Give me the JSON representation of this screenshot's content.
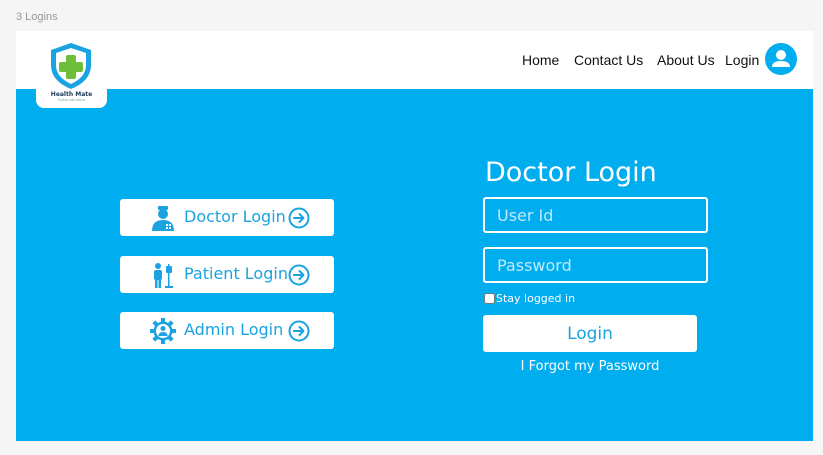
{
  "frame_label": "3 Logins",
  "logo": {
    "name": "Health Mate",
    "tagline": "Follow with Africa"
  },
  "nav": {
    "items": [
      {
        "id": "home",
        "label": "Home"
      },
      {
        "id": "contact",
        "label": "Contact Us"
      },
      {
        "id": "about",
        "label": "About Us"
      },
      {
        "id": "login",
        "label": "Login"
      }
    ],
    "avatar_icon": "user-icon"
  },
  "roles": [
    {
      "id": "doctor",
      "label": "Doctor Login",
      "icon": "doctor-icon",
      "arrow_icon": "arrow-right-circle-icon"
    },
    {
      "id": "patient",
      "label": "Patient Login",
      "icon": "patient-icon",
      "arrow_icon": "arrow-right-circle-icon"
    },
    {
      "id": "admin",
      "label": "Admin Login",
      "icon": "admin-gear-icon",
      "arrow_icon": "arrow-right-circle-icon"
    }
  ],
  "form": {
    "title": "Doctor Login",
    "user_placeholder": "User Id",
    "user_value": "",
    "password_placeholder": "Password",
    "password_value": "",
    "stay_logged_in_label": "Stay logged in",
    "stay_logged_in_checked": false,
    "submit_label": "Login",
    "forgot_label": "I Forgot my Password"
  },
  "colors": {
    "primary": "#00adee",
    "accent_text": "#1aa3e0",
    "logo_green": "#6dbf3a",
    "background": "#f5f5f5"
  }
}
